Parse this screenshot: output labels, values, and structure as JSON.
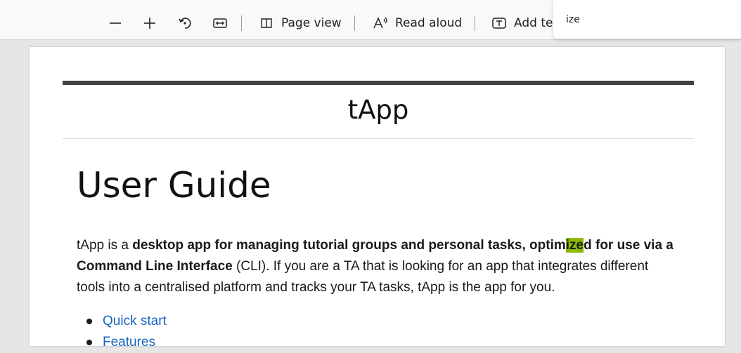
{
  "toolbar": {
    "page_view_label": "Page view",
    "read_aloud_label": "Read aloud",
    "add_text_label": "Add te",
    "icons": {
      "zoom_out": "minus-icon",
      "zoom_in": "plus-icon",
      "rotate": "rotate-icon",
      "fit": "fit-width-icon",
      "page_view": "page-view-icon",
      "read_aloud": "read-aloud-icon",
      "add_text": "add-text-icon"
    }
  },
  "find": {
    "value": "ize"
  },
  "document": {
    "site_title": "tApp",
    "heading": "User Guide",
    "para": {
      "t1": "tApp is a ",
      "b1": "desktop app for managing tutorial groups and personal tasks, optim",
      "hl": "ize",
      "b2": "d for use via a Command Line Interface",
      "t2": " (CLI). If you are a TA that is looking for an app that integrates different tools into a centralised platform and tracks your TA tasks, tApp is the app for you."
    },
    "toc": [
      "Quick start",
      "Features"
    ]
  },
  "colors": {
    "highlight": "#8dba00",
    "link": "#1565c0"
  }
}
